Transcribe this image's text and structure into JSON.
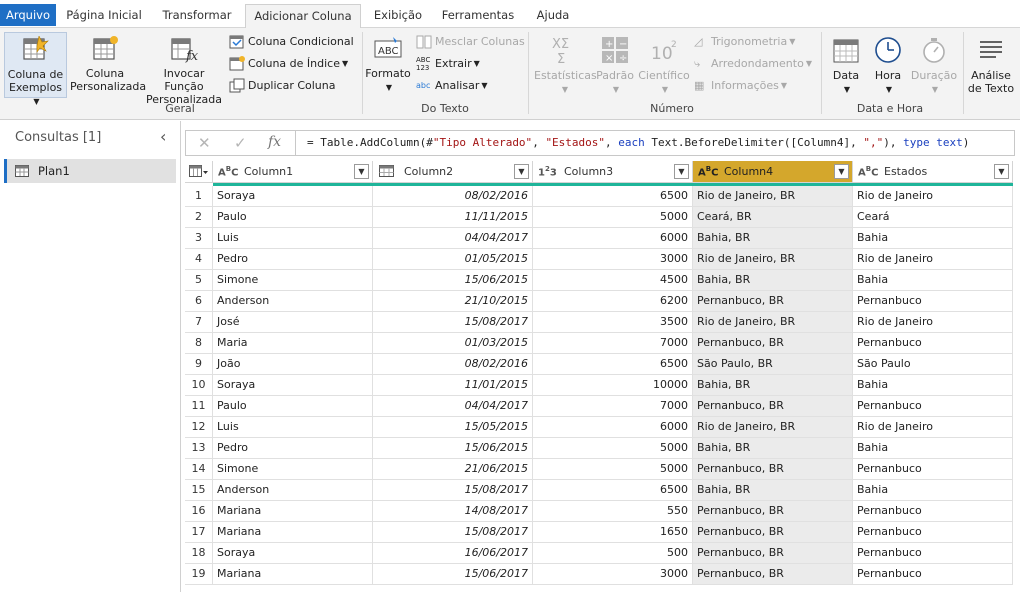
{
  "menu": {
    "tabs": [
      "Arquivo",
      "Página Inicial",
      "Transformar",
      "Adicionar Coluna",
      "Exibição",
      "Ferramentas",
      "Ajuda"
    ],
    "active": "Adicionar Coluna"
  },
  "ribbon": {
    "geral": {
      "label": "Geral",
      "coluna_exemplos_1": "Coluna de",
      "coluna_exemplos_2": "Exemplos",
      "coluna_pers_1": "Coluna",
      "coluna_pers_2": "Personalizada",
      "invocar_1": "Invocar Função",
      "invocar_2": "Personalizada",
      "coluna_condicional": "Coluna Condicional",
      "coluna_indice": "Coluna de Índice",
      "duplicar_coluna": "Duplicar Coluna"
    },
    "do_texto": {
      "label": "Do Texto",
      "formato": "Formato",
      "mesclar_colunas": "Mesclar Colunas",
      "extrair": "Extrair",
      "analisar": "Analisar"
    },
    "numero": {
      "label": "Número",
      "estatisticas": "Estatísticas",
      "padrao": "Padrão",
      "cientifico": "Científico",
      "trigonometria": "Trigonometria",
      "arredondamento": "Arredondamento",
      "informacoes": "Informações"
    },
    "data_hora": {
      "label": "Data e Hora",
      "data": "Data",
      "hora": "Hora",
      "duracao": "Duração"
    },
    "texto_extra": {
      "analise_1": "Análise",
      "analise_2": "de Texto"
    }
  },
  "queries": {
    "title": "Consultas [1]",
    "items": [
      "Plan1"
    ]
  },
  "formula": {
    "p1": "= Table.AddColumn(#",
    "s1": "\"Tipo Alterado\"",
    "p2": ", ",
    "s2": "\"Estados\"",
    "p3": ", ",
    "k1": "each",
    "p4": " Text.BeforeDelimiter([Column4], ",
    "s3": "\",\"",
    "p5": "), ",
    "k2": "type",
    "p6": " ",
    "k3": "text",
    "p7": ")"
  },
  "grid": {
    "columns": [
      {
        "type": "ABC",
        "name": "Column1"
      },
      {
        "type": "cal",
        "name": "Column2"
      },
      {
        "type": "123",
        "name": "Column3"
      },
      {
        "type": "ABC",
        "name": "Column4"
      },
      {
        "type": "ABC",
        "name": "Estados"
      }
    ],
    "selected_column": "Column4",
    "rows": [
      [
        "1",
        "Soraya",
        "08/02/2016",
        "6500",
        "Rio de Janeiro, BR",
        "Rio de Janeiro"
      ],
      [
        "2",
        "Paulo",
        "11/11/2015",
        "5000",
        "Ceará, BR",
        "Ceará"
      ],
      [
        "3",
        "Luis",
        "04/04/2017",
        "6000",
        "Bahia, BR",
        "Bahia"
      ],
      [
        "4",
        "Pedro",
        "01/05/2015",
        "3000",
        "Rio de Janeiro, BR",
        "Rio de Janeiro"
      ],
      [
        "5",
        "Simone",
        "15/06/2015",
        "4500",
        "Bahia, BR",
        "Bahia"
      ],
      [
        "6",
        "Anderson",
        "21/10/2015",
        "6200",
        "Pernanbuco, BR",
        "Pernanbuco"
      ],
      [
        "7",
        "José",
        "15/08/2017",
        "3500",
        "Rio de Janeiro, BR",
        "Rio de Janeiro"
      ],
      [
        "8",
        "Maria",
        "01/03/2015",
        "7000",
        "Pernanbuco, BR",
        "Pernanbuco"
      ],
      [
        "9",
        "João",
        "08/02/2016",
        "6500",
        "São Paulo, BR",
        "São Paulo"
      ],
      [
        "10",
        "Soraya",
        "11/01/2015",
        "10000",
        "Bahia, BR",
        "Bahia"
      ],
      [
        "11",
        "Paulo",
        "04/04/2017",
        "7000",
        "Pernanbuco, BR",
        "Pernanbuco"
      ],
      [
        "12",
        "Luis",
        "15/05/2015",
        "6000",
        "Rio de Janeiro, BR",
        "Rio de Janeiro"
      ],
      [
        "13",
        "Pedro",
        "15/06/2015",
        "5000",
        "Bahia, BR",
        "Bahia"
      ],
      [
        "14",
        "Simone",
        "21/06/2015",
        "5000",
        "Pernanbuco, BR",
        "Pernanbuco"
      ],
      [
        "15",
        "Anderson",
        "15/08/2017",
        "6500",
        "Bahia, BR",
        "Bahia"
      ],
      [
        "16",
        "Mariana",
        "14/08/2017",
        "550",
        "Pernanbuco, BR",
        "Pernanbuco"
      ],
      [
        "17",
        "Mariana",
        "15/08/2017",
        "1650",
        "Pernanbuco, BR",
        "Pernanbuco"
      ],
      [
        "18",
        "Soraya",
        "16/06/2017",
        "500",
        "Pernanbuco, BR",
        "Pernanbuco"
      ],
      [
        "19",
        "Mariana",
        "15/06/2017",
        "3000",
        "Pernanbuco, BR",
        "Pernanbuco"
      ]
    ]
  },
  "colors": {
    "accent": "#1f6fc5",
    "selected_header": "#d4a72c",
    "quality_bar": "#1fb59a",
    "string_red": "#a31515",
    "keyword_blue": "#1a3fbf"
  }
}
